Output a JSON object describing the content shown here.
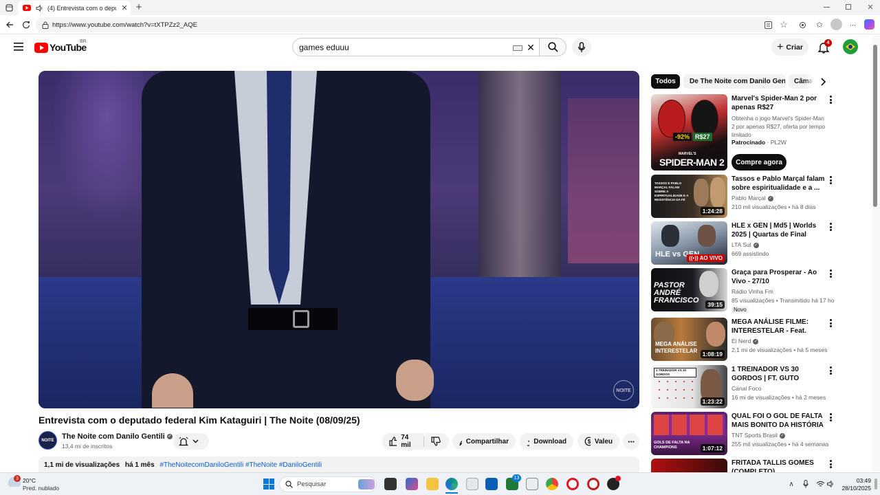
{
  "browser": {
    "tab_title": "(4) Entrevista com o deputado",
    "url": "https://www.youtube.com/watch?v=tXTPZz2_AQE"
  },
  "header": {
    "logo_text": "YouTube",
    "region": "BR",
    "search_value": "games eduuu",
    "create_label": "Criar",
    "notification_count": "4"
  },
  "video": {
    "watermark": "NOITE",
    "title": "Entrevista com o deputado federal Kim Kataguiri | The Noite (08/09/25)",
    "channel_name": "The Noite com Danilo Gentili",
    "subscribers": "13,4 mi de inscritos",
    "likes": "74 mil",
    "share_label": "Compartilhar",
    "download_label": "Download",
    "thanks_label": "Valeu",
    "views": "1,1 mi de visualizações",
    "age": "há 1 mês",
    "hashtags": "#TheNoitecomDaniloGentili #TheNoite #DaniloGentili"
  },
  "chips": [
    "Todos",
    "De The Noite com Danilo Gentili",
    "Câmara"
  ],
  "ad": {
    "title": "Marvel's Spider-Man 2 por apenas R$27",
    "description": "Obtenha o jogo Marvel's Spider-Man 2 por apenas R$27, oferta por tempo limitado",
    "sponsored": "Patrocinado",
    "advertiser": "PL2W",
    "cta": "Compre agora",
    "thumb_discount": "-92%",
    "thumb_price": "R$27",
    "thumb_text": "SPIDER-MAN 2",
    "thumb_small": "MARVEL'S"
  },
  "recommendations": [
    {
      "title": "Tassos e Pablo Marçal falam sobre espiritualidade e a ...",
      "channel": "Pablo Marçal",
      "verified": true,
      "meta": "210 mil visualizações • há 8 dias",
      "duration": "1:24:28",
      "thumb_text": "TASSOS E PABLO MARÇAL FALAM SOBRE A ESPIRITUALIDADE E A RESISTÊNCIA DA FÉ",
      "badge": ""
    },
    {
      "title": "HLE x GEN | Md5 | Worlds 2025 | Quartas de Final",
      "channel": "LTA Sul",
      "verified": true,
      "meta": "669 assistindo",
      "duration": "",
      "thumb_text": "HLE vs GEN",
      "badge": "AO VIVO"
    },
    {
      "title": "Graça para Prosperar - Ao Vivo - 27/10",
      "channel": "Rádio Vinha Fm",
      "verified": false,
      "meta": "85 visualizações • Transmitido há 17 hor...",
      "duration": "39:15",
      "thumb_text": "PASTOR ANDRÉ FRANCISCO",
      "badge": "Novo"
    },
    {
      "title": "MEGA ANÁLISE FILME: INTERESTELAR - Feat. SÉRGI...",
      "channel": "Ei Nerd",
      "verified": true,
      "meta": "2,1 mi de visualizações • há 5 meses",
      "duration": "1:08:19",
      "thumb_text": "MEGA ANÁLISE INTERESTELAR",
      "badge": ""
    },
    {
      "title": "1 TREINADOR VS 30 GORDOS | FT. GUTO GALAMBA",
      "channel": "Canal Foco",
      "verified": false,
      "meta": "16 mi de visualizações • há 2 meses",
      "duration": "1:23:22",
      "thumb_text": "1 TREINADOR VS 30 GORDOS",
      "badge": ""
    },
    {
      "title": "QUAL FOI O GOL DE FALTA MAIS BONITO DA HISTÓRIA D...",
      "channel": "TNT Sports Brasil",
      "verified": true,
      "meta": "255 mil visualizações • há 4 semanas",
      "duration": "1:07:12",
      "thumb_text": "GOLS DE FALTA NA CHAMPIONS",
      "badge": ""
    },
    {
      "title": "FRITADA TALLIS GOMES (COMPLETO)",
      "channel": "",
      "verified": false,
      "meta": "",
      "duration": "",
      "thumb_text": "",
      "badge": ""
    }
  ],
  "taskbar": {
    "weather_temp": "20°C",
    "weather_desc": "Pred. nublado",
    "weather_badge": "3",
    "search_placeholder": "Pesquisar",
    "mail_badge": "13",
    "time": "03:49",
    "date": "28/10/2025"
  },
  "colors": {
    "yt_red": "#ff0000",
    "chip_active": "#0f0f0f",
    "link_blue": "#065fd4",
    "live_red": "#cc0000"
  }
}
